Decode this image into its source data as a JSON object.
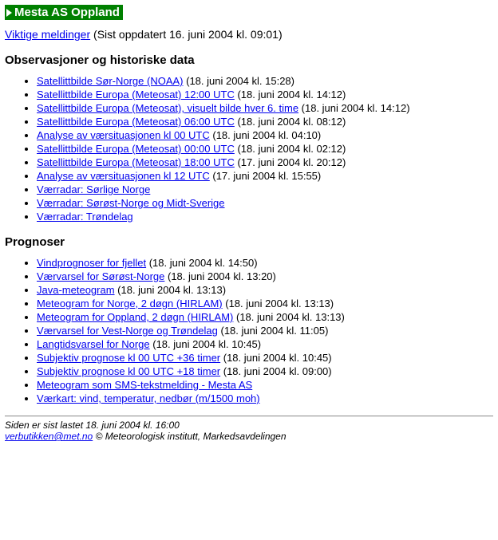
{
  "title": "Mesta AS Oppland",
  "intro": {
    "link": "Viktige meldinger",
    "suffix": " (Sist oppdatert 16. juni 2004 kl. 09:01)"
  },
  "sections": [
    {
      "heading": "Observasjoner og historiske data",
      "items": [
        {
          "label": "Satellittbilde Sør-Norge (NOAA)",
          "meta": " (18. juni 2004 kl. 15:28)"
        },
        {
          "label": "Satellittbilde Europa (Meteosat) 12:00 UTC",
          "meta": " (18. juni 2004 kl. 14:12)"
        },
        {
          "label": "Satellittbilde Europa (Meteosat), visuelt bilde hver 6. time",
          "meta": " (18. juni 2004 kl. 14:12)"
        },
        {
          "label": "Satellittbilde Europa (Meteosat) 06:00 UTC",
          "meta": " (18. juni 2004 kl. 08:12)"
        },
        {
          "label": "Analyse av værsituasjonen kl 00 UTC",
          "meta": " (18. juni 2004 kl. 04:10)"
        },
        {
          "label": "Satellittbilde Europa (Meteosat) 00:00 UTC",
          "meta": " (18. juni 2004 kl. 02:12)"
        },
        {
          "label": "Satellittbilde Europa (Meteosat) 18:00 UTC",
          "meta": " (17. juni 2004 kl. 20:12)"
        },
        {
          "label": "Analyse av værsituasjonen kl 12 UTC",
          "meta": " (17. juni 2004 kl. 15:55)"
        },
        {
          "label": "Værradar: Sørlige Norge",
          "meta": ""
        },
        {
          "label": "Værradar: Sørøst-Norge og Midt-Sverige",
          "meta": ""
        },
        {
          "label": "Værradar: Trøndelag",
          "meta": ""
        }
      ]
    },
    {
      "heading": "Prognoser",
      "items": [
        {
          "label": "Vindprognoser for fjellet",
          "meta": " (18. juni 2004 kl. 14:50)"
        },
        {
          "label": "Værvarsel for Sørøst-Norge",
          "meta": " (18. juni 2004 kl. 13:20)"
        },
        {
          "label": "Java-meteogram",
          "meta": " (18. juni 2004 kl. 13:13)"
        },
        {
          "label": "Meteogram for Norge, 2 døgn (HIRLAM)",
          "meta": " (18. juni 2004 kl. 13:13)"
        },
        {
          "label": "Meteogram for Oppland, 2 døgn (HIRLAM)",
          "meta": " (18. juni 2004 kl. 13:13)"
        },
        {
          "label": "Værvarsel for Vest-Norge og Trøndelag",
          "meta": " (18. juni 2004 kl. 11:05)"
        },
        {
          "label": "Langtidsvarsel for Norge",
          "meta": " (18. juni 2004 kl. 10:45)"
        },
        {
          "label": "Subjektiv prognose kl 00 UTC +36 timer",
          "meta": " (18. juni 2004 kl. 10:45)"
        },
        {
          "label": "Subjektiv prognose kl 00 UTC +18 timer",
          "meta": " (18. juni 2004 kl. 09:00)"
        },
        {
          "label": "Meteogram som SMS-tekstmelding - Mesta AS",
          "meta": ""
        },
        {
          "label": "Værkart: vind, temperatur, nedbør (m/1500 moh)",
          "meta": ""
        }
      ]
    }
  ],
  "footer": {
    "line1": "Siden er sist lastet 18. juni 2004 kl. 16:00",
    "email": "verbutikken@met.no",
    "copyright": " © Meteorologisk institutt, Markedsavdelingen"
  }
}
